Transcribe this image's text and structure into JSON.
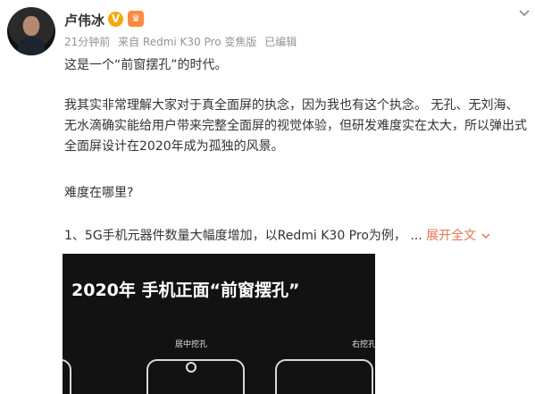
{
  "post": {
    "author": "卢伟冰",
    "verified_badge": "V",
    "member_badge_icon": "crown-icon",
    "time": "21分钟前",
    "source": "来自 Redmi K30 Pro 变焦版",
    "edited": "已编辑",
    "paragraph1": "这是一个“前窗摆孔”的时代。",
    "paragraph2": "我其实非常理解大家对于真全面屏的执念，因为我也有这个执念。 无孔、无刘海、无水滴确实能给用户带来完整全面屏的视觉体验，但研发难度实在太大，所以弹出式全面屏设计在2020年成为孤独的风景。",
    "paragraph3": "难度在哪里?",
    "paragraph4": "1、5G手机元器件数量大幅度增加，以Redmi K30 Pro为例，",
    "ellipsis": "...",
    "expand_label": "展开全文",
    "expand_color": "#eb7350"
  },
  "image": {
    "title": "2020年 手机正面“前窗摆孔”",
    "label_center": "居中挖孔",
    "label_right": "右挖孔"
  }
}
